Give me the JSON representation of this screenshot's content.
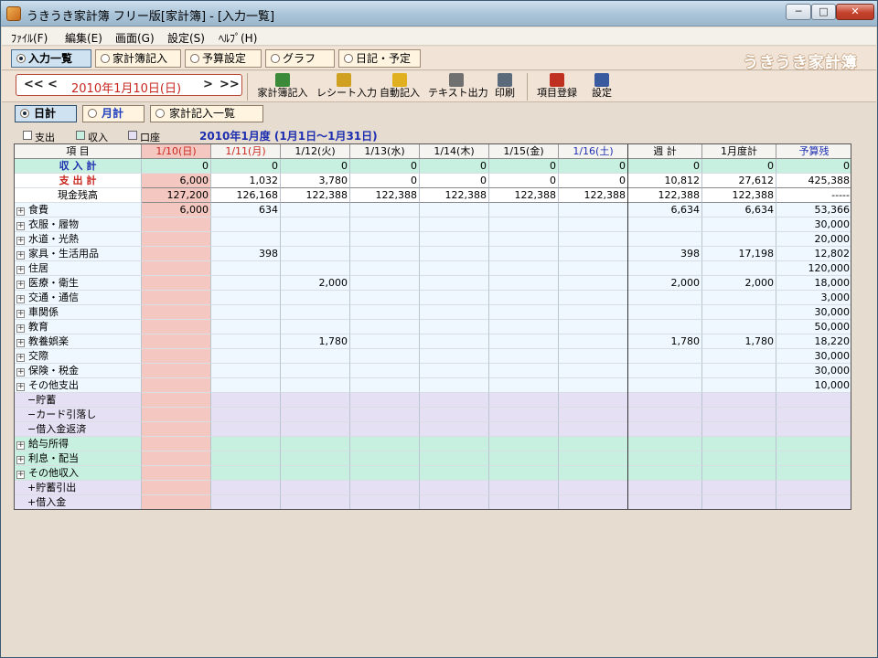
{
  "window": {
    "title": "うきうき家計簿 フリー版[家計簿] - [入力一覧]",
    "buttons": {
      "minimize": "─",
      "maximize": "□",
      "close": "✕"
    }
  },
  "menu": [
    "ﾌｧｲﾙ(F)",
    "編集(E)",
    "画面(G)",
    "設定(S)",
    "ﾍﾙﾌﾟ(H)"
  ],
  "tabs": [
    {
      "label": "入力一覧",
      "active": true
    },
    {
      "label": "家計簿記入",
      "active": false
    },
    {
      "label": "予算設定",
      "active": false
    },
    {
      "label": "グラフ",
      "active": false
    },
    {
      "label": "日記・予定",
      "active": false
    }
  ],
  "brand": "うきうき家計簿",
  "date_nav": {
    "prev_month": "<<",
    "prev_day": "<",
    "date": "2010年1月10日(日)",
    "next_day": ">",
    "next_month": ">>"
  },
  "tools": [
    {
      "label": "家計簿記入",
      "icon": "pencil-icon",
      "color": "#3a8a3a"
    },
    {
      "label": "レシート入力",
      "icon": "receipt-icon",
      "color": "#d0a020"
    },
    {
      "label": "自動記入",
      "icon": "auto-entry-icon",
      "color": "#e0b020"
    },
    {
      "label": "テキスト出力",
      "icon": "text-export-icon",
      "color": "#707070"
    },
    {
      "label": "印刷",
      "icon": "printer-icon",
      "color": "#5a6a7a"
    },
    {
      "label": "項目登録",
      "icon": "item-register-icon",
      "color": "#c03020"
    },
    {
      "label": "設定",
      "icon": "settings-icon",
      "color": "#3a5aa0"
    }
  ],
  "subtabs": [
    {
      "label": "日計",
      "active": true
    },
    {
      "label": "月計",
      "active": false
    },
    {
      "label": "家計記入一覧",
      "active": false
    }
  ],
  "legend": [
    {
      "label": "支出",
      "color": "#ffffff"
    },
    {
      "label": "収入",
      "color": "#c8f0e0"
    },
    {
      "label": "口座",
      "color": "#e6e0f4"
    }
  ],
  "period_title": "2010年1月度 (1月1日～1月31日)",
  "grid": {
    "columns": [
      {
        "label": "項 目",
        "color": "#000000"
      },
      {
        "label": "1/10(日)",
        "color": "#c8261e"
      },
      {
        "label": "1/11(月)",
        "color": "#c8261e"
      },
      {
        "label": "1/12(火)",
        "color": "#000000"
      },
      {
        "label": "1/13(水)",
        "color": "#000000"
      },
      {
        "label": "1/14(木)",
        "color": "#000000"
      },
      {
        "label": "1/15(金)",
        "color": "#000000"
      },
      {
        "label": "1/16(土)",
        "color": "#1d2fb0"
      },
      {
        "label": "週 計",
        "color": "#000000"
      },
      {
        "label": "1月度計",
        "color": "#000000"
      },
      {
        "label": "予算残",
        "color": "#1d2fb0"
      }
    ],
    "rows": [
      {
        "label": "収 入 計",
        "kind": "summary-income",
        "values": [
          "0",
          "0",
          "0",
          "0",
          "0",
          "0",
          "0",
          "0",
          "0",
          "0"
        ]
      },
      {
        "label": "支 出 計",
        "kind": "summary-expense",
        "values": [
          "6,000",
          "1,032",
          "3,780",
          "0",
          "0",
          "0",
          "0",
          "10,812",
          "27,612",
          "425,388"
        ]
      },
      {
        "label": "現金残高",
        "kind": "summary-cash",
        "values": [
          "127,200",
          "126,168",
          "122,388",
          "122,388",
          "122,388",
          "122,388",
          "122,388",
          "122,388",
          "122,388",
          "-----"
        ]
      },
      {
        "label": "食費",
        "kind": "expense",
        "values": [
          "6,000",
          "634",
          "",
          "",
          "",
          "",
          "",
          "6,634",
          "6,634",
          "53,366"
        ]
      },
      {
        "label": "衣服・履物",
        "kind": "expense",
        "values": [
          "",
          "",
          "",
          "",
          "",
          "",
          "",
          "",
          "",
          "30,000"
        ]
      },
      {
        "label": "水道・光熱",
        "kind": "expense",
        "values": [
          "",
          "",
          "",
          "",
          "",
          "",
          "",
          "",
          "",
          "20,000"
        ]
      },
      {
        "label": "家具・生活用品",
        "kind": "expense",
        "values": [
          "",
          "398",
          "",
          "",
          "",
          "",
          "",
          "398",
          "17,198",
          "12,802"
        ]
      },
      {
        "label": "住居",
        "kind": "expense",
        "values": [
          "",
          "",
          "",
          "",
          "",
          "",
          "",
          "",
          "",
          "120,000"
        ]
      },
      {
        "label": "医療・衛生",
        "kind": "expense",
        "values": [
          "",
          "",
          "2,000",
          "",
          "",
          "",
          "",
          "2,000",
          "2,000",
          "18,000"
        ]
      },
      {
        "label": "交通・通信",
        "kind": "expense",
        "values": [
          "",
          "",
          "",
          "",
          "",
          "",
          "",
          "",
          "",
          "3,000"
        ]
      },
      {
        "label": "車関係",
        "kind": "expense",
        "values": [
          "",
          "",
          "",
          "",
          "",
          "",
          "",
          "",
          "",
          "30,000"
        ]
      },
      {
        "label": "教育",
        "kind": "expense",
        "values": [
          "",
          "",
          "",
          "",
          "",
          "",
          "",
          "",
          "",
          "50,000"
        ]
      },
      {
        "label": "教養娯楽",
        "kind": "expense",
        "values": [
          "",
          "",
          "1,780",
          "",
          "",
          "",
          "",
          "1,780",
          "1,780",
          "18,220"
        ]
      },
      {
        "label": "交際",
        "kind": "expense",
        "values": [
          "",
          "",
          "",
          "",
          "",
          "",
          "",
          "",
          "",
          "30,000"
        ]
      },
      {
        "label": "保険・税金",
        "kind": "expense",
        "values": [
          "",
          "",
          "",
          "",
          "",
          "",
          "",
          "",
          "",
          "30,000"
        ]
      },
      {
        "label": "その他支出",
        "kind": "expense",
        "values": [
          "",
          "",
          "",
          "",
          "",
          "",
          "",
          "",
          "",
          "10,000"
        ]
      },
      {
        "label": "−貯蓄",
        "kind": "account",
        "values": [
          "",
          "",
          "",
          "",
          "",
          "",
          "",
          "",
          "",
          ""
        ]
      },
      {
        "label": "−カード引落し",
        "kind": "account",
        "values": [
          "",
          "",
          "",
          "",
          "",
          "",
          "",
          "",
          "",
          ""
        ]
      },
      {
        "label": "−借入金返済",
        "kind": "account",
        "values": [
          "",
          "",
          "",
          "",
          "",
          "",
          "",
          "",
          "",
          ""
        ]
      },
      {
        "label": "給与所得",
        "kind": "income",
        "values": [
          "",
          "",
          "",
          "",
          "",
          "",
          "",
          "",
          "",
          ""
        ]
      },
      {
        "label": "利息・配当",
        "kind": "income",
        "values": [
          "",
          "",
          "",
          "",
          "",
          "",
          "",
          "",
          "",
          ""
        ]
      },
      {
        "label": "その他収入",
        "kind": "income",
        "values": [
          "",
          "",
          "",
          "",
          "",
          "",
          "",
          "",
          "",
          ""
        ]
      },
      {
        "label": "+貯蓄引出",
        "kind": "account2",
        "values": [
          "",
          "",
          "",
          "",
          "",
          "",
          "",
          "",
          "",
          ""
        ]
      },
      {
        "label": "+借入金",
        "kind": "account2",
        "values": [
          "",
          "",
          "",
          "",
          "",
          "",
          "",
          "",
          "",
          ""
        ]
      }
    ]
  },
  "colors": {
    "expense_bg": "#f0f8ff",
    "income_bg": "#c8f0e0",
    "account_bg": "#e6e0f4",
    "today_bg": "#f4c8c0",
    "income_label": "#1d2fb0",
    "expense_label": "#c8261e"
  }
}
